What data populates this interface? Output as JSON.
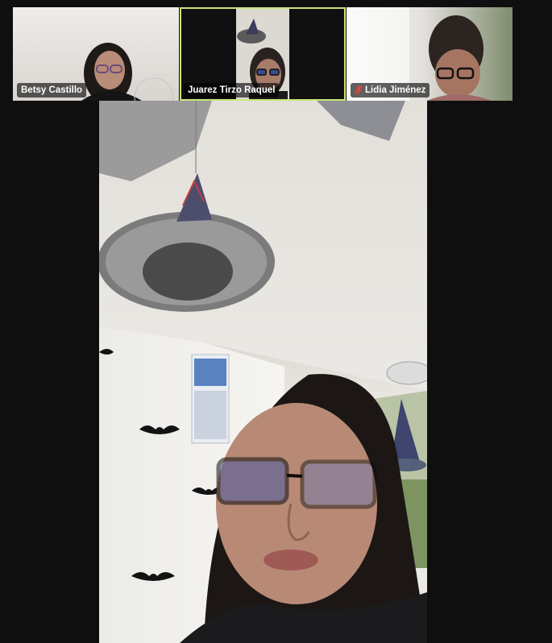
{
  "participants": [
    {
      "name": "Betsy Castillo",
      "muted": false,
      "active": false
    },
    {
      "name": "Juarez Tirzo Raquel",
      "muted": false,
      "active": true
    },
    {
      "name": "Lidia Jiménez",
      "muted": true,
      "active": false
    }
  ],
  "colors": {
    "background": "#0f0f0f",
    "active_speaker_border": "#c8e57a",
    "muted_icon": "#e0463a"
  },
  "icons": {
    "muted": "mic-muted-icon"
  }
}
